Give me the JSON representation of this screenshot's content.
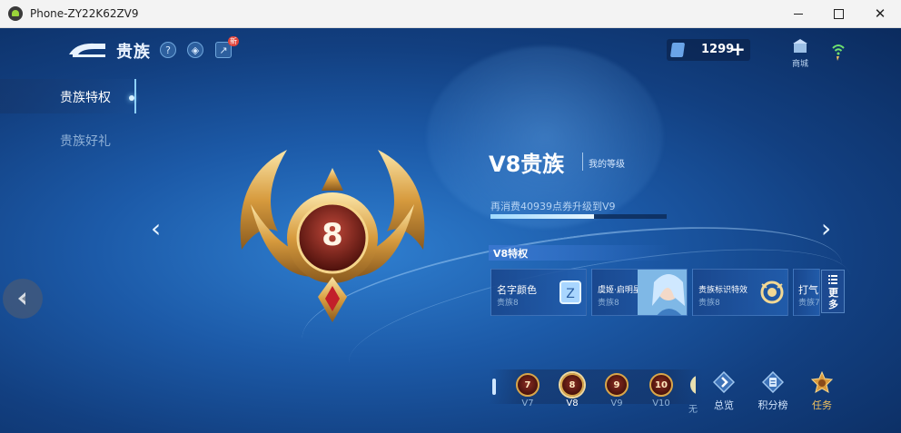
{
  "window": {
    "title": "Phone-ZY22K62ZV9"
  },
  "header": {
    "title": "贵族",
    "new_badge": "新"
  },
  "sidebar": {
    "items": [
      {
        "label": "贵族特权",
        "active": true
      },
      {
        "label": "贵族好礼",
        "active": false
      }
    ]
  },
  "currency": {
    "value": "1299",
    "plus": "+"
  },
  "shop": {
    "label": "商城"
  },
  "level": {
    "title": "V8贵族",
    "my_level_label": "我的等级",
    "badge_number": "8",
    "progress_text": "再消费40939点券升级到V9",
    "progress_fraction": 0.59
  },
  "privileges": {
    "header": "V8特权",
    "cards": [
      {
        "name": "名字颜色",
        "sub": "贵族8"
      },
      {
        "name": "虞姬·启明星使",
        "sub": "贵族8"
      },
      {
        "name": "贵族标识特效",
        "sub": "贵族8"
      },
      {
        "name": "打气",
        "sub": "贵族7"
      }
    ],
    "more_label": "更多"
  },
  "level_strip": {
    "items": [
      {
        "number": "7",
        "label": "V7",
        "current": false
      },
      {
        "number": "8",
        "label": "V8",
        "current": true
      },
      {
        "number": "9",
        "label": "V9",
        "current": false
      },
      {
        "number": "10",
        "label": "V10",
        "current": false
      }
    ],
    "partial_label": "无"
  },
  "bottom_nav": [
    {
      "label": "总览"
    },
    {
      "label": "积分榜"
    },
    {
      "label": "任务"
    }
  ],
  "colors": {
    "accent_gold": "#f2c25e",
    "progress": "#cfeeff",
    "background": "#1c5aa8"
  }
}
